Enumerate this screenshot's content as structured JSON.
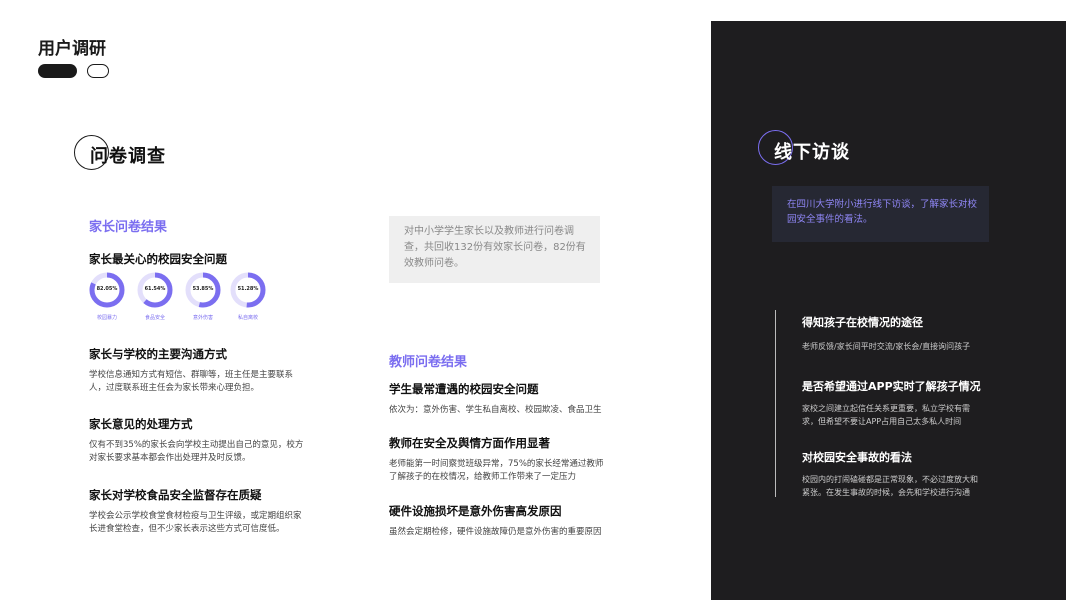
{
  "page": {
    "title": "用户调研"
  },
  "survey": {
    "section_title": "问卷调查",
    "parents": {
      "heading": "家长问卷结果",
      "concern_title": "家长最关心的校园安全问题",
      "donuts": [
        {
          "value": "82.05%",
          "percent": 82.05,
          "label": "校园暴力"
        },
        {
          "value": "61.54%",
          "percent": 61.54,
          "label": "食品安全"
        },
        {
          "value": "53.85%",
          "percent": 53.85,
          "label": "意外伤害"
        },
        {
          "value": "51.28%",
          "percent": 51.28,
          "label": "私自离校"
        }
      ],
      "blocks": [
        {
          "title": "家长与学校的主要沟通方式",
          "lines": [
            "学校信息通知方式有短信、群聊等，班主任是主要联系",
            "人，过度联系班主任会为家长带来心理负担。"
          ]
        },
        {
          "title": "家长意见的处理方式",
          "lines": [
            "仅有不到35%的家长会向学校主动提出自己的意见，校方",
            "对家长要求基本都会作出处理并及时反馈。"
          ]
        },
        {
          "title": "家长对学校食品安全监督存在质疑",
          "lines": [
            "学校会公示学校食堂食材检疫与卫生评级，或定期组织家",
            "长进食堂检查，但不少家长表示这些方式可信度低。"
          ]
        }
      ]
    },
    "intro": "对中小学学生家长以及教师进行问卷调查，共回收132份有效家长问卷，82份有效教师问卷。",
    "teachers": {
      "heading": "教师问卷结果",
      "blocks": [
        {
          "title": "学生最常遭遇的校园安全问题",
          "lines": [
            "依次为：意外伤害、学生私自离校、校园欺凌、食品卫生"
          ]
        },
        {
          "title": "教师在安全及舆情方面作用显著",
          "lines": [
            "老师能第一时间察觉班级异常，75%的家长经常通过教师",
            "了解孩子的在校情况，给教师工作带来了一定压力"
          ]
        },
        {
          "title": "硬件设施损坏是意外伤害高发原因",
          "lines": [
            "虽然会定期检修，硬件设施故障仍是意外伤害的重要原因"
          ]
        }
      ]
    }
  },
  "interview": {
    "section_title": "线下访谈",
    "intro": "在四川大学附小进行线下访谈，了解家长对校园安全事件的看法。",
    "blocks": [
      {
        "title": "得知孩子在校情况的途径",
        "lines": [
          "老师反馈/家长间平时交流/家长会/直接询问孩子"
        ]
      },
      {
        "title": "是否希望通过APP实时了解孩子情况",
        "lines": [
          "家校之间建立起信任关系更重要，私立学校有需",
          "求，但希望不要让APP占用自己太多私人时间"
        ]
      },
      {
        "title": "对校园安全事故的看法",
        "lines": [
          "校园内的打闹磕碰都是正常现象，不必过度放大和",
          "紧张。在发生事故的时候，会先和学校进行沟通"
        ]
      }
    ]
  },
  "colors": {
    "accent": "#7b6ef0",
    "donut_track": "#e3dffb",
    "dark_panel": "#1e1d1f"
  }
}
